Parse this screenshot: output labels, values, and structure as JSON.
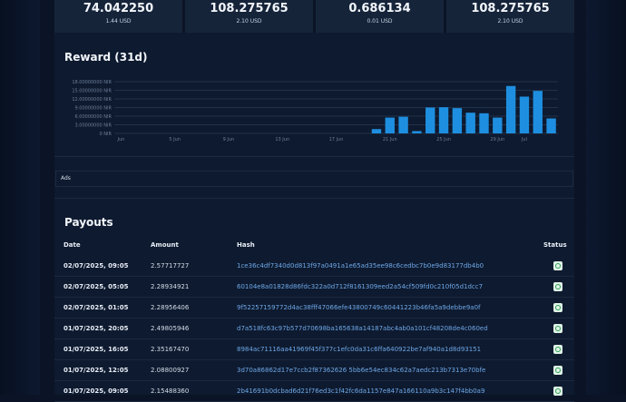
{
  "stats": [
    {
      "value": "74.042250",
      "sub": "1.44 USD"
    },
    {
      "value": "108.275765",
      "sub": "2.10 USD"
    },
    {
      "value": "0.686134",
      "sub": "0.01 USD"
    },
    {
      "value": "108.275765",
      "sub": "2.10 USD"
    }
  ],
  "reward": {
    "title": "Reward (31d)"
  },
  "chart_data": {
    "type": "bar",
    "title": "Reward (31d)",
    "ylim": [
      0,
      18
    ],
    "y_ticks": [
      "0 NIR",
      "3.00000000 NIR",
      "6.00000000 NIR",
      "9.00000000 NIR",
      "12.00000000 NIR",
      "15.00000000 NIR",
      "18.00000000 NIR"
    ],
    "x_ticks": [
      "Jun",
      "5 Jun",
      "9 Jun",
      "13 Jun",
      "17 Jun",
      "21 Jun",
      "25 Jun",
      "29 Jun",
      "Jul"
    ],
    "values": [
      0,
      0,
      0,
      0,
      0,
      0,
      0,
      0,
      0,
      0,
      0,
      0,
      0,
      0,
      0,
      0,
      0,
      0,
      0,
      1.5,
      5.5,
      5.8,
      0.8,
      9.0,
      9.1,
      8.8,
      7.2,
      7.0,
      5.5,
      16.5,
      12.8,
      14.8,
      5.2
    ],
    "grid": true,
    "color": "#1e8fe0"
  },
  "ads": {
    "label": "Ads"
  },
  "payouts": {
    "title": "Payouts",
    "headers": {
      "date": "Date",
      "amount": "Amount",
      "hash": "Hash",
      "status": "Status"
    },
    "rows": [
      {
        "date": "02/07/2025, 09:05",
        "amount": "2.57717727",
        "hash": "1ce36c4df7340d0d813f97a0491a1e65ad35ee98c6cedbc7b0e9d83177db4b0"
      },
      {
        "date": "02/07/2025, 05:05",
        "amount": "2.28934921",
        "hash": "60104e8a01828d86fdc322a0d712f8161309eed2a54cf509fd0c210f05d1dcc7"
      },
      {
        "date": "02/07/2025, 01:05",
        "amount": "2.28956406",
        "hash": "9f52257159772d4ac38fff47066efe43800749c60441223b46fa5a9debbe9a0f"
      },
      {
        "date": "01/07/2025, 20:05",
        "amount": "2.49805946",
        "hash": "d7a518fc63c97b577d70698ba165638a14187abc4ab0a101cf48208de4c060ed"
      },
      {
        "date": "01/07/2025, 16:05",
        "amount": "2.35167470",
        "hash": "8984ac71116aa41969f45f377c1efc0da31c6ffa640922be7af940a1d8d93151"
      },
      {
        "date": "01/07/2025, 12:05",
        "amount": "2.08800927",
        "hash": "3d70a86862d17e7ccb2f87362626 5bb6e54ec834c62a7aedc213b7313e70bfe"
      },
      {
        "date": "01/07/2025, 09:05",
        "amount": "2.15488360",
        "hash": "2b41691b0dcbad6d21f76ed3c1f42fc6da1157e847a166110a9b3c147f4bb0a9"
      }
    ]
  }
}
